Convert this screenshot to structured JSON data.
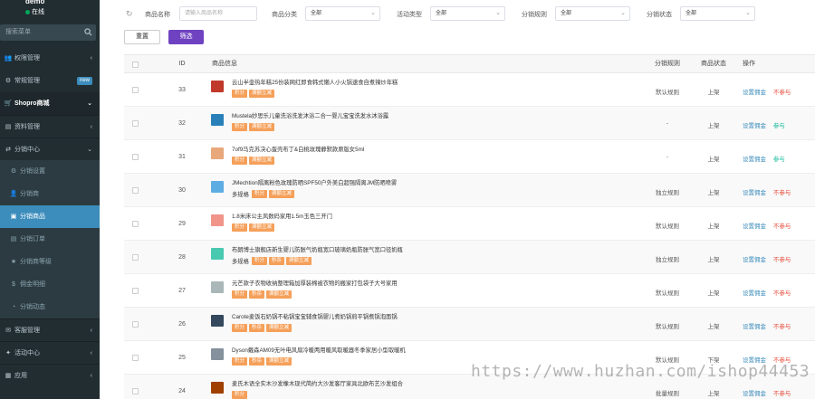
{
  "sidebar": {
    "username": "demo",
    "status": "在线",
    "search_placeholder": "搜索菜单",
    "items": [
      {
        "label": "权限管理",
        "icon": "group-icon",
        "chevron": "‹",
        "type": "head2"
      },
      {
        "label": "常规管理",
        "icon": "gear-icon",
        "badge": "new",
        "type": "head2"
      },
      {
        "label": "Shopro商城",
        "icon": "cart-icon",
        "chevron": "⌄",
        "type": "head"
      },
      {
        "label": "资料管理",
        "icon": "book-icon",
        "chevron": "‹",
        "type": "sub"
      },
      {
        "label": "分销中心",
        "icon": "share-icon",
        "chevron": "⌄",
        "type": "sub"
      },
      {
        "label": "分销设置",
        "icon": "cog-icon",
        "type": "sub2"
      },
      {
        "label": "分销商",
        "icon": "user-icon",
        "type": "sub2"
      },
      {
        "label": "分销商品",
        "icon": "cube-icon",
        "type": "active"
      },
      {
        "label": "分销订单",
        "icon": "order-icon",
        "type": "sub2"
      },
      {
        "label": "分销商等级",
        "icon": "star-icon",
        "type": "sub2"
      },
      {
        "label": "佣金明细",
        "icon": "dollar-icon",
        "type": "sub2"
      },
      {
        "label": "分销动态",
        "icon": "activity-icon",
        "type": "sub2"
      },
      {
        "label": "客服管理",
        "icon": "chat-icon",
        "chevron": "‹",
        "type": "sub"
      },
      {
        "label": "活动中心",
        "icon": "gift-icon",
        "chevron": "‹",
        "type": "sub"
      },
      {
        "label": "应用",
        "icon": "apps-icon",
        "chevron": "‹",
        "type": "sub"
      }
    ]
  },
  "filters": {
    "goods_name_label": "商品名称",
    "goods_name_placeholder": "请输入商品名称",
    "category_label": "商品分类",
    "category_value": "全部",
    "activity_label": "活动类型",
    "activity_value": "全部",
    "rule_label": "分销规则",
    "rule_value": "全部",
    "dist_status_label": "分销状态",
    "dist_status_value": "全部",
    "reset_label": "重置",
    "filter_label": "筛选"
  },
  "table": {
    "headers": {
      "id": "ID",
      "info": "商品信息",
      "rule": "分销规则",
      "status": "商品状态",
      "op": "操作"
    },
    "op_set_label": "设置佣金",
    "rows": [
      {
        "id": "33",
        "name": "云山半壶热年糕25份装网红即食韩式懒人小火锅速食自煮辣炒年糕",
        "multi": "",
        "tags": [
          "积分",
          "满额立减"
        ],
        "rule": "默认规则",
        "status": "上架",
        "join": "不参与",
        "joined": false,
        "thumb": "#c0392b"
      },
      {
        "id": "32",
        "name": "Mustela妙思乐儿童洗浴洗发沐浴二合一婴儿宝宝洗发水沐浴露",
        "multi": "",
        "tags": [
          "积分",
          "满额立减"
        ],
        "rule": "-",
        "status": "上架",
        "join": "参与",
        "joined": true,
        "thumb": "#2980b9"
      },
      {
        "id": "31",
        "name": "7of9马克苏决心蛋壳布丁&白桃玫瑰静默款原版女5ml",
        "multi": "",
        "tags": [
          "积分",
          "满额立减"
        ],
        "rule": "-",
        "status": "上架",
        "join": "参与",
        "joined": true,
        "thumb": "#e8a87c"
      },
      {
        "id": "30",
        "name": "JMechtion隔离粉色玫瑰防晒SPF50户外美白超强隔离JM防晒喷雾",
        "multi": "多规格",
        "tags": [
          "积分",
          "满额立减"
        ],
        "rule": "独立规则",
        "status": "上架",
        "join": "不参与",
        "joined": false,
        "thumb": "#5dade2"
      },
      {
        "id": "29",
        "name": "1.8米床公主风数码家用1.5m玉色三开门",
        "multi": "",
        "tags": [
          "积分",
          "满额立减"
        ],
        "rule": "默认规则",
        "status": "上架",
        "join": "不参与",
        "joined": false,
        "thumb": "#f1948a"
      },
      {
        "id": "28",
        "name": "布朗博士旗舰店新生婴儿防胀气奶瓶宽口玻璃奶瓶防胀气宽口径奶瓶",
        "multi": "多规格",
        "tags": [
          "积分",
          "秒杀",
          "满额立减"
        ],
        "rule": "独立规则",
        "status": "上架",
        "join": "不参与",
        "joined": false,
        "thumb": "#48c9b0"
      },
      {
        "id": "27",
        "name": "元芒款子衣物收纳整理箱加厚装棉被衣物的搬家打包袋子大号家用",
        "multi": "",
        "tags": [
          "积分",
          "秒杀",
          "满额立减"
        ],
        "rule": "默认规则",
        "status": "上架",
        "join": "不参与",
        "joined": false,
        "thumb": "#aab7b8"
      },
      {
        "id": "26",
        "name": "Carote麦饭石奶锅不粘锅宝宝辅食锅婴儿煮奶锅煎平锅煮锅泡面锅",
        "multi": "",
        "tags": [
          "积分",
          "秒杀",
          "满额立减"
        ],
        "rule": "默认规则",
        "status": "上架",
        "join": "不参与",
        "joined": false,
        "thumb": "#34495e"
      },
      {
        "id": "25",
        "name": "Dyson戴森AM09无叶电风扇冷暖两用暖风取暖器冬季家居小型取暖机",
        "multi": "",
        "tags": [
          "积分",
          "秒杀",
          "满额立减"
        ],
        "rule": "默认规则",
        "status": "下架",
        "join": "不参与",
        "joined": false,
        "thumb": "#85929e"
      },
      {
        "id": "24",
        "name": "麦氏木语全实木沙发橡木现代简约大沙发客厅家具北欧布艺沙发组合",
        "multi": "",
        "tags": [
          "积分"
        ],
        "rule": "批量规则",
        "status": "上架",
        "join": "不参与",
        "joined": false,
        "thumb": "#a04000"
      }
    ]
  },
  "watermark": "https://www.huzhan.com/ishop44453",
  "colors": {
    "sidebar_bg": "#222d32",
    "active": "#3c8dbc",
    "primary_button": "#6f42c1",
    "tag": "#f5a05a",
    "no_join": "#e74c3c",
    "join": "#18bc9c"
  }
}
